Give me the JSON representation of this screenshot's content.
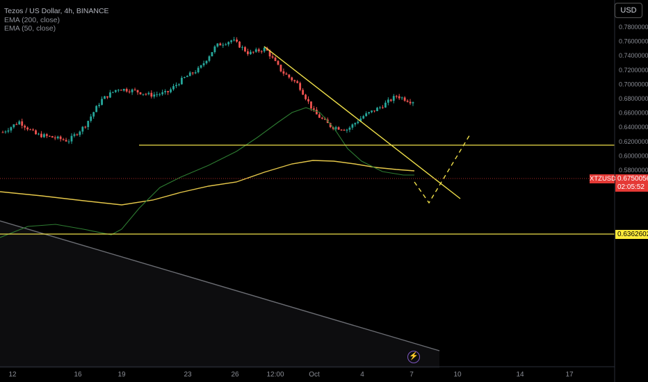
{
  "legend": {
    "title": "Tezos / US Dollar, 4h, BINANCE",
    "ema200": "EMA (200, close)",
    "ema50": "EMA (50, close)"
  },
  "currency": "USD",
  "symbol": "XTZUSD",
  "last_price": "0.67500569",
  "countdown": "02:05:52",
  "support_price": "0.63626023",
  "colors": {
    "up": "#26a69a",
    "down": "#ef5350",
    "ema200": "#e6c84a",
    "ema50": "#3a7a3e",
    "drawings": "#f0e04a",
    "price_tag": "#e53935",
    "support_tag": "#ffeb3b"
  },
  "chart_data": {
    "type": "candlestick",
    "title": "Tezos / US Dollar, 4h, BINANCE",
    "y_axis": {
      "ticks": [
        "0.78000000",
        "0.76000000",
        "0.74000000",
        "0.72000000",
        "0.70000000",
        "0.68000000",
        "0.66000000",
        "0.64000000",
        "0.62000000",
        "0.60000000",
        "0.58000000",
        "0.56000000"
      ],
      "values": [
        0.78,
        0.76,
        0.74,
        0.72,
        0.7,
        0.68,
        0.66,
        0.64,
        0.62,
        0.6,
        0.58,
        0.56
      ],
      "ylim": [
        0.548,
        0.792
      ]
    },
    "x_axis": {
      "ticks": [
        "12",
        "16",
        "19",
        "23",
        "26",
        "12:00",
        "Oct",
        "4",
        "7",
        "10",
        "14",
        "17"
      ]
    },
    "price_path": [
      [
        "Sep 11",
        0.633
      ],
      [
        "Sep 13",
        0.648
      ],
      [
        "Sep 15",
        0.63
      ],
      [
        "Sep 17",
        0.626
      ],
      [
        "Sep 18",
        0.621
      ],
      [
        "Sep 19",
        0.642
      ],
      [
        "Sep 20",
        0.678
      ],
      [
        "Sep 21",
        0.694
      ],
      [
        "Sep 22",
        0.691
      ],
      [
        "Sep 23",
        0.685
      ],
      [
        "Sep 24",
        0.688
      ],
      [
        "Sep 25",
        0.708
      ],
      [
        "Sep 26",
        0.722
      ],
      [
        "Sep 27",
        0.754
      ],
      [
        "Sep 28",
        0.762
      ],
      [
        "Sep 29",
        0.743
      ],
      [
        "Sep 30",
        0.75
      ],
      [
        "Oct 1",
        0.718
      ],
      [
        "Oct 2",
        0.7
      ],
      [
        "Oct 2 12:00",
        0.66
      ],
      [
        "Oct 3",
        0.641
      ],
      [
        "Oct 4",
        0.637
      ],
      [
        "Oct 5",
        0.656
      ],
      [
        "Oct 6",
        0.668
      ],
      [
        "Oct 7",
        0.684
      ],
      [
        "Oct 7 12:00",
        0.675
      ]
    ],
    "series": [
      {
        "name": "EMA (200, close)",
        "values": [
          [
            0.654
          ],
          [
            0.658
          ],
          [
            0.666
          ],
          [
            0.672
          ],
          [
            0.683
          ],
          [
            0.686
          ],
          [
            0.682
          ],
          [
            0.679
          ]
        ]
      },
      {
        "name": "EMA (50, close)",
        "values": [
          [
            0.637
          ],
          [
            0.64
          ],
          [
            0.658
          ],
          [
            0.676
          ],
          [
            0.696
          ],
          [
            0.714
          ],
          [
            0.724
          ],
          [
            0.7
          ],
          [
            0.68
          ],
          [
            0.676
          ]
        ]
      }
    ],
    "annotations": [
      "horizontal resistance at 0.699",
      "horizontal support at 0.63626023",
      "descending trendline from ~0.768 to ~0.658",
      "projected path down to ~0.658 then up to ~0.706"
    ],
    "current_price": 0.67500569
  }
}
